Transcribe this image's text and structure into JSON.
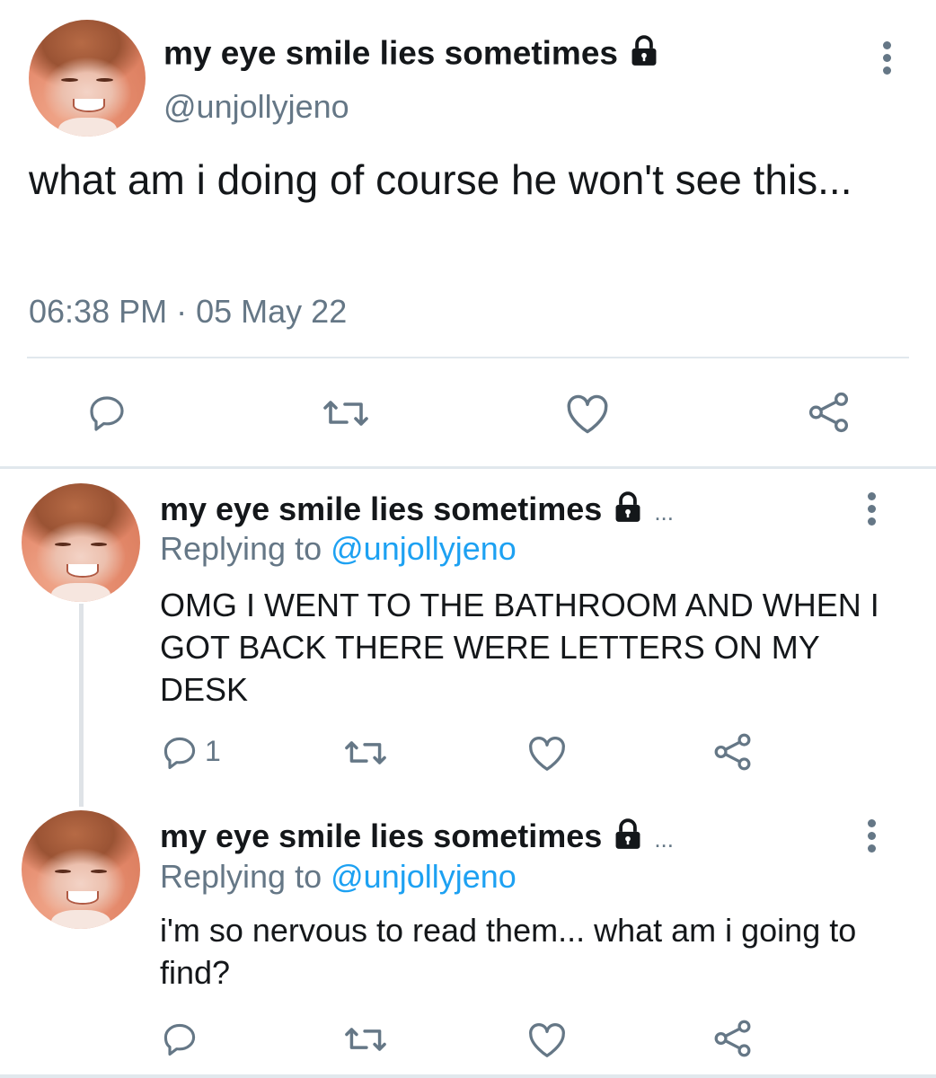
{
  "main_tweet": {
    "display_name": "my eye smile lies sometimes",
    "handle": "@unjollyjeno",
    "text": "what am i doing of course he won't see this...",
    "time": "06:38 PM",
    "separator": "·",
    "date": "05 May 22"
  },
  "replies": [
    {
      "display_name": "my eye smile lies sometimes",
      "ellipsis": "...",
      "replying_prefix": "Replying to",
      "replying_handle": "@unjollyjeno",
      "text": "OMG I WENT TO THE BATHROOM AND WHEN I GOT BACK THERE WERE LETTERS ON MY DESK",
      "reply_count": "1"
    },
    {
      "display_name": "my eye smile lies sometimes",
      "ellipsis": "...",
      "replying_prefix": "Replying to",
      "replying_handle": "@unjollyjeno",
      "text": "i'm so nervous to read them... what am i going to find?",
      "reply_count": ""
    }
  ],
  "icons": {
    "lock": "lock-icon",
    "more": "more-vertical-icon",
    "reply": "reply-icon",
    "retweet": "retweet-icon",
    "like": "heart-icon",
    "share": "share-icon"
  },
  "colors": {
    "text": "#14171a",
    "muted": "#657786",
    "link": "#1da1f2",
    "divider": "#e1e8ed"
  }
}
